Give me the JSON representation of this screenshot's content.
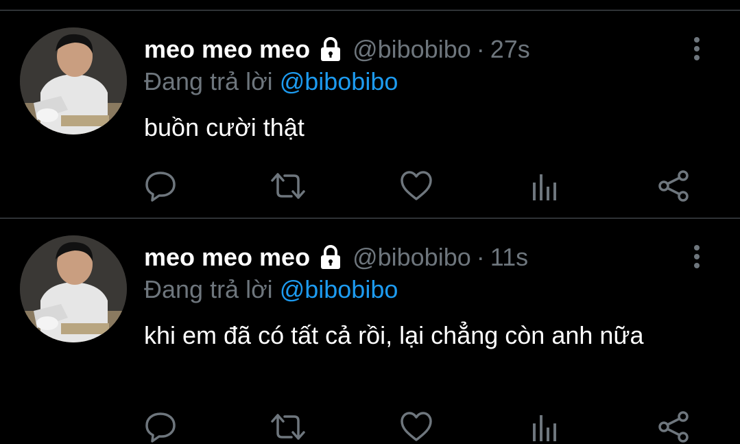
{
  "colors": {
    "background": "#000000",
    "divider": "#2f3336",
    "muted": "#6e767d",
    "mention": "#1d9bf0",
    "text": "#ffffff"
  },
  "tweets": [
    {
      "display_name": "meo meo meo",
      "handle": "@bibobibo",
      "separator": "·",
      "time": "27s",
      "replying_prefix": "Đang trả lời",
      "replying_to": "@bibobibo",
      "text": "buồn cười thật",
      "icons": [
        "lock-icon",
        "more-vertical-icon",
        "reply-icon",
        "retweet-icon",
        "like-icon",
        "analytics-icon",
        "share-icon"
      ]
    },
    {
      "display_name": "meo meo meo",
      "handle": "@bibobibo",
      "separator": "·",
      "time": "11s",
      "replying_prefix": "Đang trả lời",
      "replying_to": "@bibobibo",
      "text": "khi em đã có tất cả rồi, lại chẳng còn anh nữa",
      "icons": [
        "lock-icon",
        "more-vertical-icon",
        "reply-icon",
        "retweet-icon",
        "like-icon",
        "analytics-icon",
        "share-icon"
      ]
    }
  ]
}
